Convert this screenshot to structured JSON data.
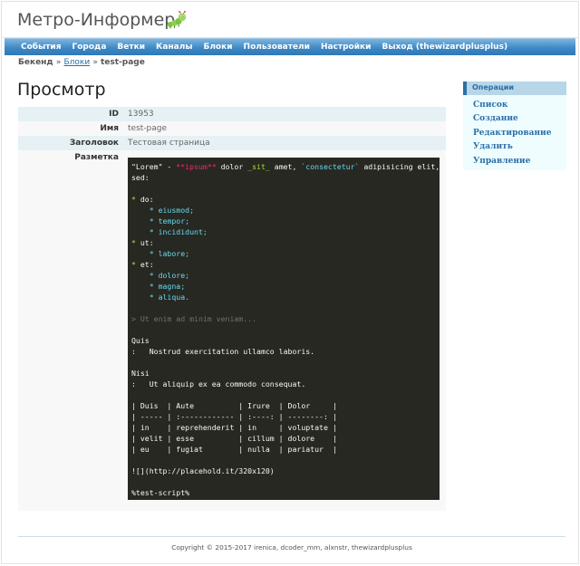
{
  "app": {
    "title": "Метро-Информер",
    "logo_icon": "green-caterpillar-icon"
  },
  "menu": {
    "items": [
      {
        "label": "События"
      },
      {
        "label": "Города"
      },
      {
        "label": "Ветки"
      },
      {
        "label": "Каналы"
      },
      {
        "label": "Блоки"
      },
      {
        "label": "Пользователи"
      },
      {
        "label": "Настройки"
      },
      {
        "label": "Выход (thewizardplusplus)"
      }
    ]
  },
  "breadcrumb": {
    "root": "Бекенд",
    "sep1": "»",
    "link": "Блоки",
    "sep2": "»",
    "current": "test-page"
  },
  "page": {
    "heading": "Просмотр"
  },
  "detail": {
    "rows": [
      {
        "label": "ID",
        "value": "13953"
      },
      {
        "label": "Имя",
        "value": "test-page"
      },
      {
        "label": "Заголовок",
        "value": "Тестовая страница"
      },
      {
        "label": "Разметка",
        "value": ""
      }
    ]
  },
  "markup": {
    "lines": [
      "\"Lorem\" - **ipsum** dolor _sit_ amet, `consectetur` adipisicing elit,",
      "sed:",
      "",
      "* do:",
      "    * eiusmod;",
      "    * tempor;",
      "    * incididunt;",
      "* ut:",
      "    * labore;",
      "* et:",
      "    * dolore;",
      "    * magna;",
      "    * aliqua.",
      "",
      "> Ut enim ad minim veniam...",
      "",
      "Quis",
      ":   Nostrud exercitation ullamco laboris.",
      "",
      "Nisi",
      ":   Ut aliquip ex ea commodo consequat.",
      "",
      "| Duis  | Aute          | Irure  | Dolor     |",
      "| ----- | :------------ | :----: | --------: |",
      "| in    | reprehenderit | in     | voluptate |",
      "| velit | esse          | cillum | dolore    |",
      "| eu    | fugiat        | nulla  | pariatur  |",
      "",
      "![](http://placehold.it/320x120)",
      "",
      "%test-script%"
    ],
    "colors": {
      "background": "#272822",
      "text": "#f8f8f2",
      "emphasis": "#f92672",
      "bullet": "#a6e22e",
      "code": "#e6db74",
      "list_item": "#66d9ef",
      "quote": "#75715e"
    }
  },
  "sidebar": {
    "title": "Операции",
    "items": [
      {
        "label": "Список"
      },
      {
        "label": "Создание"
      },
      {
        "label": "Редактирование"
      },
      {
        "label": "Удалить"
      },
      {
        "label": "Управление"
      }
    ]
  },
  "footer": {
    "copyright": "Copyright © 2015-2017 irenica, dcoder_mm, alxnstr, thewizardplusplus"
  },
  "colors": {
    "accent": "#2b6fa8",
    "menu_bar": "#3a86c4",
    "row_highlight": "#e5f1f4",
    "sidebar_bg": "#effdff"
  }
}
